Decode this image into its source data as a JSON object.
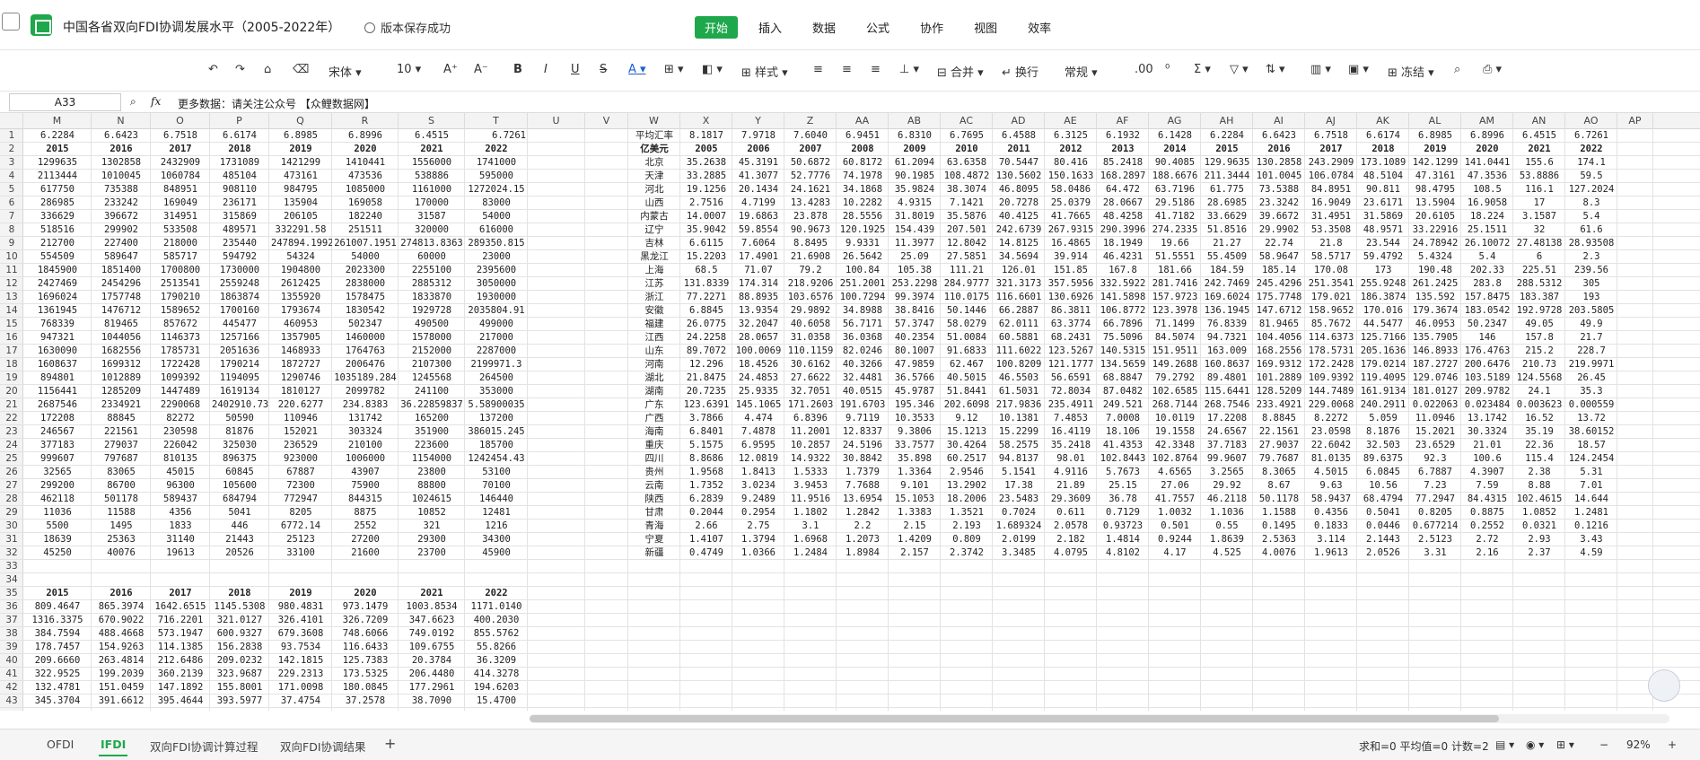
{
  "window": {
    "title": "中国各省双向FDI协调发展水平（2005-2022年）",
    "save_status": "版本保存成功"
  },
  "menu": [
    "开始",
    "插入",
    "数据",
    "公式",
    "协作",
    "视图",
    "效率"
  ],
  "toolbar": {
    "font_name": "宋体",
    "font_size": "10",
    "style_label": "样式",
    "merge_label": "合并",
    "wrap_label": "换行",
    "number_format": "常规",
    "freeze_label": "冻结"
  },
  "formula": {
    "cell_ref": "A33",
    "fx": "fx",
    "content": "更多数据：请关注公众号 【众鲤数据网】"
  },
  "columns": [
    "M",
    "N",
    "O",
    "P",
    "Q",
    "R",
    "S",
    "T",
    "U",
    "V",
    "W",
    "X",
    "Y",
    "Z",
    "AA",
    "AB",
    "AC",
    "AD",
    "AE",
    "AF",
    "AG",
    "AH",
    "AI",
    "AJ",
    "AK",
    "AL",
    "AM",
    "AN",
    "AO",
    "AP"
  ],
  "rows": [
    "1",
    "2",
    "3",
    "4",
    "5",
    "6",
    "7",
    "8",
    "9",
    "10",
    "11",
    "12",
    "13",
    "14",
    "15",
    "16",
    "17",
    "18",
    "19",
    "20",
    "21",
    "22",
    "23",
    "24",
    "25",
    "26",
    "27",
    "28",
    "29",
    "30",
    "31",
    "32",
    "33",
    "34",
    "35",
    "36",
    "37",
    "38",
    "39",
    "40",
    "41",
    "42",
    "43"
  ],
  "grid_left": {
    "rate_row": [
      "6.2284",
      "6.6423",
      "6.7518",
      "6.6174",
      "6.8985",
      "6.8996",
      "6.4515",
      "6.7261"
    ],
    "years": [
      "2015",
      "2016",
      "2017",
      "2018",
      "2019",
      "2020",
      "2021",
      "2022"
    ],
    "values": [
      [
        "1299635",
        "1302858",
        "2432909",
        "1731089",
        "1421299",
        "1410441",
        "1556000",
        "1741000"
      ],
      [
        "2113444",
        "1010045",
        "1060784",
        "485104",
        "473161",
        "473536",
        "538886",
        "595000"
      ],
      [
        "617750",
        "735388",
        "848951",
        "908110",
        "984795",
        "1085000",
        "1161000",
        "1272024.15"
      ],
      [
        "286985",
        "233242",
        "169049",
        "236171",
        "135904",
        "169058",
        "170000",
        "83000"
      ],
      [
        "336629",
        "396672",
        "314951",
        "315869",
        "206105",
        "182240",
        "31587",
        "54000"
      ],
      [
        "518516",
        "299902",
        "533508",
        "489571",
        "332291.58",
        "251511",
        "320000",
        "616000"
      ],
      [
        "212700",
        "227400",
        "218000",
        "235440",
        "247894.1992",
        "261007.1951",
        "274813.8363",
        "289350.815"
      ],
      [
        "554509",
        "589647",
        "585717",
        "594792",
        "54324",
        "54000",
        "60000",
        "23000"
      ],
      [
        "1845900",
        "1851400",
        "1700800",
        "1730000",
        "1904800",
        "2023300",
        "2255100",
        "2395600"
      ],
      [
        "2427469",
        "2454296",
        "2513541",
        "2559248",
        "2612425",
        "2838000",
        "2885312",
        "3050000"
      ],
      [
        "1696024",
        "1757748",
        "1790210",
        "1863874",
        "1355920",
        "1578475",
        "1833870",
        "1930000"
      ],
      [
        "1361945",
        "1476712",
        "1589652",
        "1700160",
        "1793674",
        "1830542",
        "1929728",
        "2035804.91"
      ],
      [
        "768339",
        "819465",
        "857672",
        "445477",
        "460953",
        "502347",
        "490500",
        "499000"
      ],
      [
        "947321",
        "1044056",
        "1146373",
        "1257166",
        "1357905",
        "1460000",
        "1578000",
        "217000"
      ],
      [
        "1630090",
        "1682556",
        "1785731",
        "2051636",
        "1468933",
        "1764763",
        "2152000",
        "2287000"
      ],
      [
        "1608637",
        "1699312",
        "1722428",
        "1790214",
        "1872727",
        "2006476",
        "2107300",
        "2199971.3"
      ],
      [
        "894801",
        "1012889",
        "1099392",
        "1194095",
        "1290746",
        "1035189.284",
        "1245568",
        "264500"
      ],
      [
        "1156441",
        "1285209",
        "1447489",
        "1619134",
        "1810127",
        "2099782",
        "241100",
        "353000"
      ],
      [
        "2687546",
        "2334921",
        "2290068",
        "2402910.732",
        "220.6277",
        "234.8383",
        "36.22859837",
        "5.58900035"
      ],
      [
        "172208",
        "88845",
        "82272",
        "50590",
        "110946",
        "131742",
        "165200",
        "137200"
      ],
      [
        "246567",
        "221561",
        "230598",
        "81876",
        "152021",
        "303324",
        "351900",
        "386015.245"
      ],
      [
        "377183",
        "279037",
        "226042",
        "325030",
        "236529",
        "210100",
        "223600",
        "185700"
      ],
      [
        "999607",
        "797687",
        "810135",
        "896375",
        "923000",
        "1006000",
        "1154000",
        "1242454.43"
      ],
      [
        "32565",
        "83065",
        "45015",
        "60845",
        "67887",
        "43907",
        "23800",
        "53100"
      ],
      [
        "299200",
        "86700",
        "96300",
        "105600",
        "72300",
        "75900",
        "88800",
        "70100"
      ],
      [
        "462118",
        "501178",
        "589437",
        "684794",
        "772947",
        "844315",
        "1024615",
        "146440"
      ],
      [
        "11036",
        "11588",
        "4356",
        "5041",
        "8205",
        "8875",
        "10852",
        "12481"
      ],
      [
        "5500",
        "1495",
        "1833",
        "446",
        "6772.14",
        "2552",
        "321",
        "1216"
      ],
      [
        "18639",
        "25363",
        "31140",
        "21443",
        "25123",
        "27200",
        "29300",
        "34300"
      ],
      [
        "45250",
        "40076",
        "19613",
        "20526",
        "33100",
        "21600",
        "23700",
        "45900"
      ]
    ],
    "years2": [
      "2015",
      "2016",
      "2017",
      "2018",
      "2019",
      "2020",
      "2021",
      "2022"
    ],
    "values2": [
      [
        "809.4647",
        "865.3974",
        "1642.6515",
        "1145.5308",
        "980.4831",
        "973.1479",
        "1003.8534",
        "1171.0140"
      ],
      [
        "1316.3375",
        "670.9022",
        "716.2201",
        "321.0127",
        "326.4101",
        "326.7209",
        "347.6623",
        "400.2030"
      ],
      [
        "384.7594",
        "488.4668",
        "573.1947",
        "600.9327",
        "679.3608",
        "748.6066",
        "749.0192",
        "855.5762"
      ],
      [
        "178.7457",
        "154.9263",
        "114.1385",
        "156.2838",
        "93.7534",
        "116.6433",
        "109.6755",
        "55.8266"
      ],
      [
        "209.6660",
        "263.4814",
        "212.6486",
        "209.0232",
        "142.1815",
        "125.7383",
        "20.3784",
        "36.3209"
      ],
      [
        "322.9525",
        "199.2039",
        "360.2139",
        "323.9687",
        "229.2313",
        "173.5325",
        "206.4480",
        "414.3278"
      ],
      [
        "132.4781",
        "151.0459",
        "147.1892",
        "155.8001",
        "171.0098",
        "180.0845",
        "177.2961",
        "194.6203"
      ],
      [
        "345.3704",
        "391.6612",
        "395.4644",
        "393.5977",
        "37.4754",
        "37.2578",
        "38.7090",
        "15.4700"
      ]
    ]
  },
  "grid_right": {
    "label_rate": "平均汇率",
    "label_unit": "亿美元",
    "rates": [
      "8.1817",
      "7.9718",
      "7.6040",
      "6.9451",
      "6.8310",
      "6.7695",
      "6.4588",
      "6.3125",
      "6.1932",
      "6.1428",
      "6.2284",
      "6.6423",
      "6.7518",
      "6.6174",
      "6.8985",
      "6.8996",
      "6.4515",
      "6.7261"
    ],
    "years": [
      "2005",
      "2006",
      "2007",
      "2008",
      "2009",
      "2010",
      "2011",
      "2012",
      "2013",
      "2014",
      "2015",
      "2016",
      "2017",
      "2018",
      "2019",
      "2020",
      "2021",
      "2022"
    ],
    "provinces": [
      "北京",
      "天津",
      "河北",
      "山西",
      "内蒙古",
      "辽宁",
      "吉林",
      "黑龙江",
      "上海",
      "江苏",
      "浙江",
      "安徽",
      "福建",
      "江西",
      "山东",
      "河南",
      "湖北",
      "湖南",
      "广东",
      "广西",
      "海南",
      "重庆",
      "四川",
      "贵州",
      "云南",
      "陕西",
      "甘肃",
      "青海",
      "宁夏",
      "新疆"
    ],
    "values": [
      [
        "35.2638",
        "45.3191",
        "50.6872",
        "60.8172",
        "61.2094",
        "63.6358",
        "70.5447",
        "80.416",
        "85.2418",
        "90.4085",
        "129.9635",
        "130.2858",
        "243.2909",
        "173.1089",
        "142.1299",
        "141.0441",
        "155.6",
        "174.1"
      ],
      [
        "33.2885",
        "41.3077",
        "52.7776",
        "74.1978",
        "90.1985",
        "108.4872",
        "130.5602",
        "150.1633",
        "168.2897",
        "188.6676",
        "211.3444",
        "101.0045",
        "106.0784",
        "48.5104",
        "47.3161",
        "47.3536",
        "53.8886",
        "59.5"
      ],
      [
        "19.1256",
        "20.1434",
        "24.1621",
        "34.1868",
        "35.9824",
        "38.3074",
        "46.8095",
        "58.0486",
        "64.472",
        "63.7196",
        "61.775",
        "73.5388",
        "84.8951",
        "90.811",
        "98.4795",
        "108.5",
        "116.1",
        "127.2024"
      ],
      [
        "2.7516",
        "4.7199",
        "13.4283",
        "10.2282",
        "4.9315",
        "7.1421",
        "20.7278",
        "25.0379",
        "28.0667",
        "29.5186",
        "28.6985",
        "23.3242",
        "16.9049",
        "23.6171",
        "13.5904",
        "16.9058",
        "17",
        "8.3"
      ],
      [
        "14.0007",
        "19.6863",
        "23.878",
        "28.5556",
        "31.8019",
        "35.5876",
        "40.4125",
        "41.7665",
        "48.4258",
        "41.7182",
        "33.6629",
        "39.6672",
        "31.4951",
        "31.5869",
        "20.6105",
        "18.224",
        "3.1587",
        "5.4"
      ],
      [
        "35.9042",
        "59.8554",
        "90.9673",
        "120.1925",
        "154.439",
        "207.501",
        "242.6739",
        "267.9315",
        "290.3996",
        "274.2335",
        "51.8516",
        "29.9902",
        "53.3508",
        "48.9571",
        "33.22916",
        "25.1511",
        "32",
        "61.6"
      ],
      [
        "6.6115",
        "7.6064",
        "8.8495",
        "9.9331",
        "11.3977",
        "12.8042",
        "14.8125",
        "16.4865",
        "18.1949",
        "19.66",
        "21.27",
        "22.74",
        "21.8",
        "23.544",
        "24.78942",
        "26.10072",
        "27.48138",
        "28.93508"
      ],
      [
        "15.2203",
        "17.4901",
        "21.6908",
        "26.5642",
        "25.09",
        "27.5851",
        "34.5694",
        "39.914",
        "46.4231",
        "51.5551",
        "55.4509",
        "58.9647",
        "58.5717",
        "59.4792",
        "5.4324",
        "5.4",
        "6",
        "2.3"
      ],
      [
        "68.5",
        "71.07",
        "79.2",
        "100.84",
        "105.38",
        "111.21",
        "126.01",
        "151.85",
        "167.8",
        "181.66",
        "184.59",
        "185.14",
        "170.08",
        "173",
        "190.48",
        "202.33",
        "225.51",
        "239.56"
      ],
      [
        "131.8339",
        "174.314",
        "218.9206",
        "251.2001",
        "253.2298",
        "284.9777",
        "321.3173",
        "357.5956",
        "332.5922",
        "281.7416",
        "242.7469",
        "245.4296",
        "251.3541",
        "255.9248",
        "261.2425",
        "283.8",
        "288.5312",
        "305"
      ],
      [
        "77.2271",
        "88.8935",
        "103.6576",
        "100.7294",
        "99.3974",
        "110.0175",
        "116.6601",
        "130.6926",
        "141.5898",
        "157.9723",
        "169.6024",
        "175.7748",
        "179.021",
        "186.3874",
        "135.592",
        "157.8475",
        "183.387",
        "193"
      ],
      [
        "6.8845",
        "13.9354",
        "29.9892",
        "34.8988",
        "38.8416",
        "50.1446",
        "66.2887",
        "86.3811",
        "106.8772",
        "123.3978",
        "136.1945",
        "147.6712",
        "158.9652",
        "170.016",
        "179.3674",
        "183.0542",
        "192.9728",
        "203.5805"
      ],
      [
        "26.0775",
        "32.2047",
        "40.6058",
        "56.7171",
        "57.3747",
        "58.0279",
        "62.0111",
        "63.3774",
        "66.7896",
        "71.1499",
        "76.8339",
        "81.9465",
        "85.7672",
        "44.5477",
        "46.0953",
        "50.2347",
        "49.05",
        "49.9"
      ],
      [
        "24.2258",
        "28.0657",
        "31.0358",
        "36.0368",
        "40.2354",
        "51.0084",
        "60.5881",
        "68.2431",
        "75.5096",
        "84.5074",
        "94.7321",
        "104.4056",
        "114.6373",
        "125.7166",
        "135.7905",
        "146",
        "157.8",
        "21.7"
      ],
      [
        "89.7072",
        "100.0069",
        "110.1159",
        "82.0246",
        "80.1007",
        "91.6833",
        "111.6022",
        "123.5267",
        "140.5315",
        "151.9511",
        "163.009",
        "168.2556",
        "178.5731",
        "205.1636",
        "146.8933",
        "176.4763",
        "215.2",
        "228.7"
      ],
      [
        "12.296",
        "18.4526",
        "30.6162",
        "40.3266",
        "47.9859",
        "62.467",
        "100.8209",
        "121.1777",
        "134.5659",
        "149.2688",
        "160.8637",
        "169.9312",
        "172.2428",
        "179.0214",
        "187.2727",
        "200.6476",
        "210.73",
        "219.9971"
      ],
      [
        "21.8475",
        "24.4853",
        "27.6622",
        "32.4481",
        "36.5766",
        "40.5015",
        "46.5503",
        "56.6591",
        "68.8847",
        "79.2792",
        "89.4801",
        "101.2889",
        "109.9392",
        "119.4095",
        "129.0746",
        "103.5189",
        "124.5568",
        "26.45"
      ],
      [
        "20.7235",
        "25.9335",
        "32.7051",
        "40.0515",
        "45.9787",
        "51.8441",
        "61.5031",
        "72.8034",
        "87.0482",
        "102.6585",
        "115.6441",
        "128.5209",
        "144.7489",
        "161.9134",
        "181.0127",
        "209.9782",
        "24.1",
        "35.3"
      ],
      [
        "123.6391",
        "145.1065",
        "171.2603",
        "191.6703",
        "195.346",
        "202.6098",
        "217.9836",
        "235.4911",
        "249.521",
        "268.7144",
        "268.7546",
        "233.4921",
        "229.0068",
        "240.2911",
        "0.022063",
        "0.023484",
        "0.003623",
        "0.000559"
      ],
      [
        "3.7866",
        "4.474",
        "6.8396",
        "9.7119",
        "10.3533",
        "9.12",
        "10.1381",
        "7.4853",
        "7.0008",
        "10.0119",
        "17.2208",
        "8.8845",
        "8.2272",
        "5.059",
        "11.0946",
        "13.1742",
        "16.52",
        "13.72"
      ],
      [
        "6.8401",
        "7.4878",
        "11.2001",
        "12.8337",
        "9.3806",
        "15.1213",
        "15.2299",
        "16.4119",
        "18.106",
        "19.1558",
        "24.6567",
        "22.1561",
        "23.0598",
        "8.1876",
        "15.2021",
        "30.3324",
        "35.19",
        "38.60152"
      ],
      [
        "5.1575",
        "6.9595",
        "10.2857",
        "24.5196",
        "33.7577",
        "30.4264",
        "58.2575",
        "35.2418",
        "41.4353",
        "42.3348",
        "37.7183",
        "27.9037",
        "22.6042",
        "32.503",
        "23.6529",
        "21.01",
        "22.36",
        "18.57"
      ],
      [
        "8.8686",
        "12.0819",
        "14.9322",
        "30.8842",
        "35.898",
        "60.2517",
        "94.8137",
        "98.01",
        "102.8443",
        "102.8764",
        "99.9607",
        "79.7687",
        "81.0135",
        "89.6375",
        "92.3",
        "100.6",
        "115.4",
        "124.2454"
      ],
      [
        "1.9568",
        "1.8413",
        "1.5333",
        "1.7379",
        "1.3364",
        "2.9546",
        "5.1541",
        "4.9116",
        "5.7673",
        "4.6565",
        "3.2565",
        "8.3065",
        "4.5015",
        "6.0845",
        "6.7887",
        "4.3907",
        "2.38",
        "5.31"
      ],
      [
        "1.7352",
        "3.0234",
        "3.9453",
        "7.7688",
        "9.101",
        "13.2902",
        "17.38",
        "21.89",
        "25.15",
        "27.06",
        "29.92",
        "8.67",
        "9.63",
        "10.56",
        "7.23",
        "7.59",
        "8.88",
        "7.01"
      ],
      [
        "6.2839",
        "9.2489",
        "11.9516",
        "13.6954",
        "15.1053",
        "18.2006",
        "23.5483",
        "29.3609",
        "36.78",
        "41.7557",
        "46.2118",
        "50.1178",
        "58.9437",
        "68.4794",
        "77.2947",
        "84.4315",
        "102.4615",
        "14.644"
      ],
      [
        "0.2044",
        "0.2954",
        "1.1802",
        "1.2842",
        "1.3383",
        "1.3521",
        "0.7024",
        "0.611",
        "0.7129",
        "1.0032",
        "1.1036",
        "1.1588",
        "0.4356",
        "0.5041",
        "0.8205",
        "0.8875",
        "1.0852",
        "1.2481"
      ],
      [
        "2.66",
        "2.75",
        "3.1",
        "2.2",
        "2.15",
        "2.193",
        "1.689324",
        "2.0578",
        "0.93723",
        "0.501",
        "0.55",
        "0.1495",
        "0.1833",
        "0.0446",
        "0.677214",
        "0.2552",
        "0.0321",
        "0.1216"
      ],
      [
        "1.4107",
        "1.3794",
        "1.6968",
        "1.2073",
        "1.4209",
        "0.809",
        "2.0199",
        "2.182",
        "1.4814",
        "0.9244",
        "1.8639",
        "2.5363",
        "3.114",
        "2.1443",
        "2.5123",
        "2.72",
        "2.93",
        "3.43"
      ],
      [
        "0.4749",
        "1.0366",
        "1.2484",
        "1.8984",
        "2.157",
        "2.3742",
        "3.3485",
        "4.0795",
        "4.8102",
        "4.17",
        "4.525",
        "4.0076",
        "1.9613",
        "2.0526",
        "3.31",
        "2.16",
        "2.37",
        "4.59"
      ]
    ]
  },
  "tabs": [
    "OFDI",
    "IFDI",
    "双向FDI协调计算过程",
    "双向FDI协调结果"
  ],
  "active_tab": "IFDI",
  "status": {
    "summary": "求和=0 平均值=0 计数=2",
    "zoom": "92%"
  }
}
